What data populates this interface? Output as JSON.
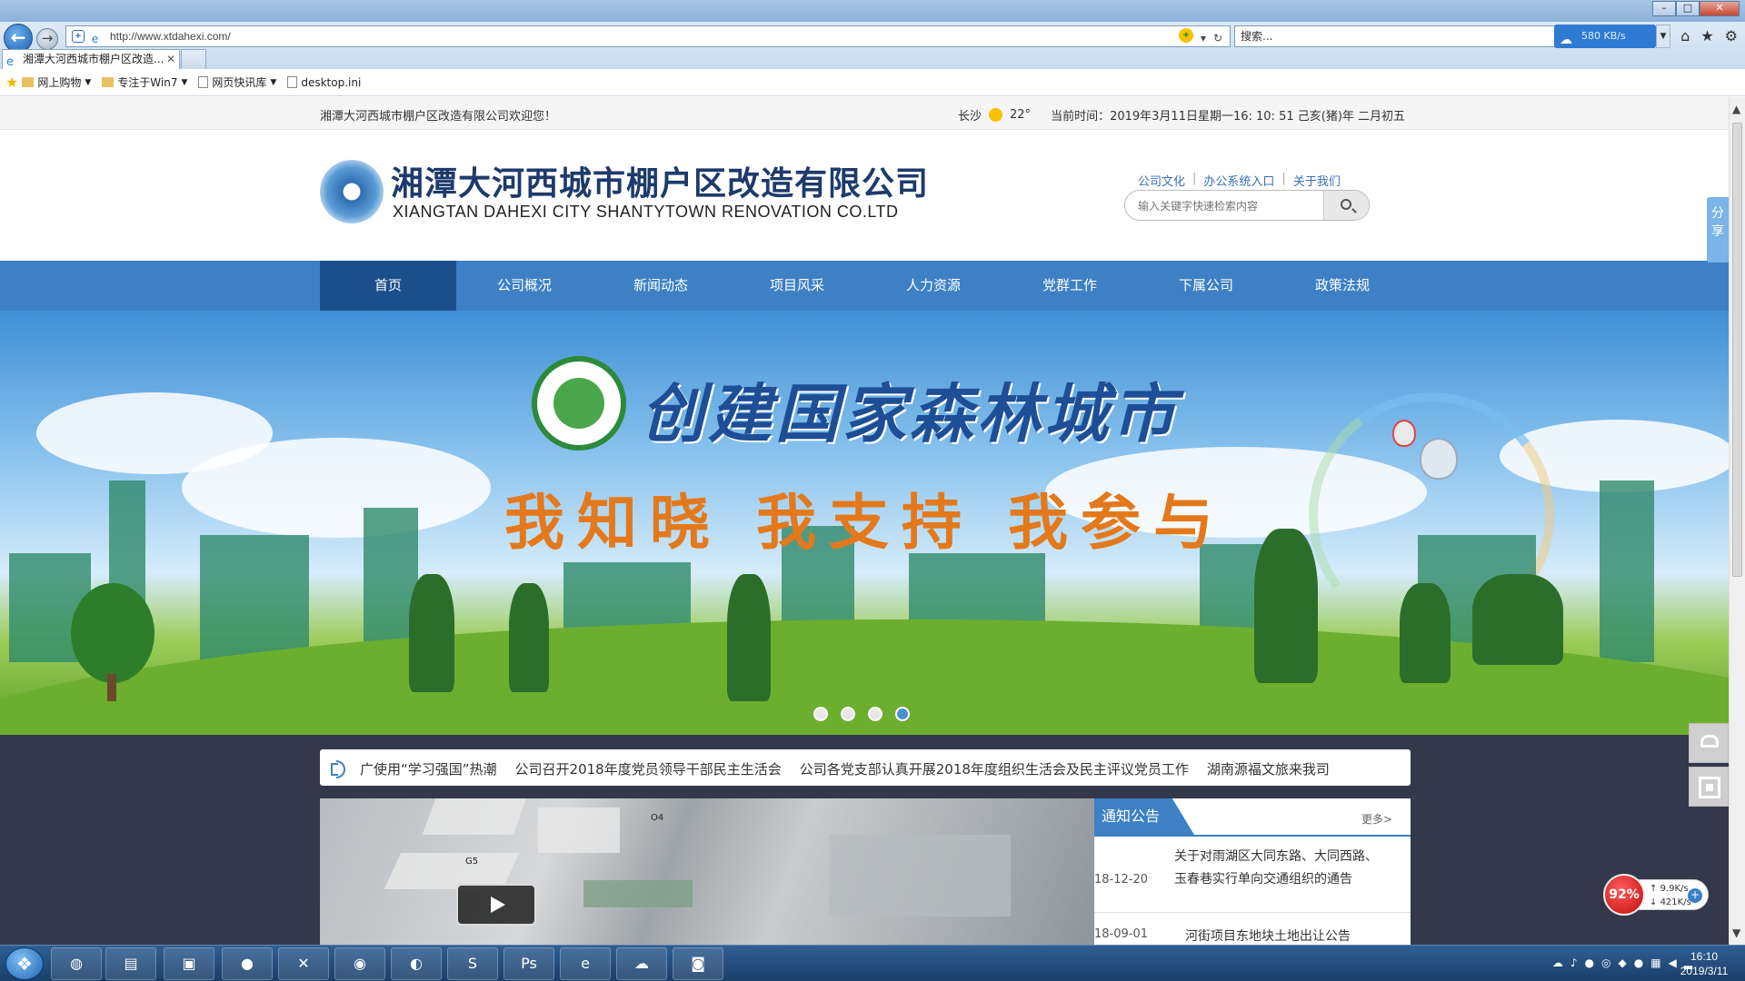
{
  "browser": {
    "url": "http://www.xtdahexi.com/",
    "tab_title": "湘潭大河西城市棚户区改造...",
    "search_placeholder": "搜索...",
    "download_speed": "580 KB/s",
    "favorites": [
      {
        "label": "网上购物"
      },
      {
        "label": "专注于Win7"
      },
      {
        "label": "网页快讯库"
      },
      {
        "label": "desktop.ini"
      }
    ]
  },
  "page": {
    "topbar": {
      "welcome": "湘潭大河西城市棚户区改造有限公司欢迎您！",
      "city": "长沙",
      "temp": "22°",
      "time": "当前时间：2019年3月11日星期一16: 10: 51  己亥(猪)年 二月初五"
    },
    "header": {
      "logo_cn": "湘潭大河西城市棚户区改造有限公司",
      "logo_en": "XIANGTAN DAHEXI CITY SHANTYTOWN RENOVATION CO.LTD",
      "links": [
        "公司文化",
        "办公系统入口",
        "关于我们"
      ],
      "search_placeholder": "输入关键字快速检索内容"
    },
    "nav": [
      "首页",
      "公司概况",
      "新闻动态",
      "项目风采",
      "人力资源",
      "党群工作",
      "下属公司",
      "政策法规"
    ],
    "banner": {
      "title": "创建国家森林城市",
      "slogan": "我知晓 我支持 我参与",
      "slide_count": 4,
      "active_slide": 4
    },
    "ticker": [
      "广使用“学习强国”热潮",
      "公司召开2018年度党员领导干部民主生活会",
      "公司各党支部认真开展2018年度组织生活会及民主评议党员工作",
      "湖南源福文旅来我司"
    ],
    "video": {
      "labels": [
        "O4",
        "G5"
      ]
    },
    "notice": {
      "title": "通知公告",
      "more": "更多>",
      "items": [
        {
          "date": "18-12-20",
          "text": "关于对雨湖区大同东路、大同西路、玉春巷实行单向交通组织的通告"
        },
        {
          "date": "18-09-01",
          "text": "河街项目东地块土地出让公告"
        }
      ]
    },
    "side": {
      "share": "分享"
    }
  },
  "monitor": {
    "percent": "92%",
    "up": "9.9K/s",
    "down": "421K/s"
  },
  "taskbar": {
    "time": "16:10",
    "date": "2019/3/11"
  }
}
